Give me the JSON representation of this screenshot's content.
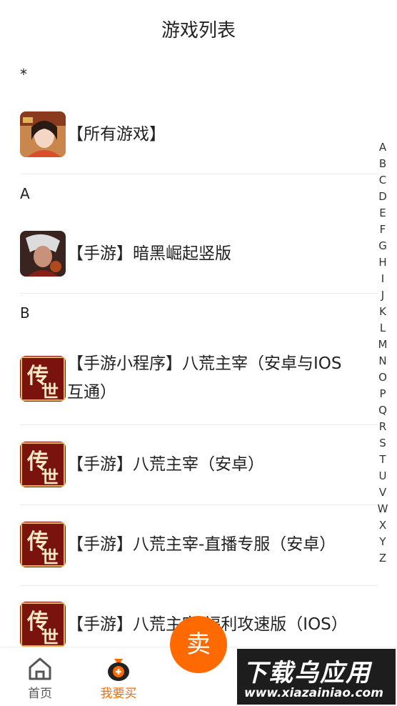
{
  "header": {
    "title": "游戏列表"
  },
  "sections": [
    {
      "key": "*",
      "items": [
        {
          "label": "【所有游戏】"
        }
      ]
    },
    {
      "key": "A",
      "items": [
        {
          "label": "【手游】暗黑崛起竖版"
        }
      ]
    },
    {
      "key": "B",
      "items": [
        {
          "label_line1": "【手游小程序】八荒主宰（安卓与IOS",
          "label_line2": "互通）"
        },
        {
          "label": "【手游】八荒主宰（安卓）"
        },
        {
          "label": "【手游】八荒主宰-直播专服（安卓）"
        },
        {
          "label": "【手游】八荒主宰-福利攻速版（IOS）"
        }
      ]
    }
  ],
  "index_letters": [
    "A",
    "B",
    "C",
    "D",
    "E",
    "F",
    "G",
    "H",
    "I",
    "J",
    "K",
    "L",
    "M",
    "N",
    "O",
    "P",
    "Q",
    "R",
    "S",
    "T",
    "U",
    "V",
    "W",
    "X",
    "Y",
    "Z"
  ],
  "tabbar": {
    "home_label": "首页",
    "buy_label": "我要买",
    "sell_label": "卖",
    "home_icon": "home-icon",
    "buy_icon": "money-bag-icon"
  },
  "watermark": {
    "main": "下载乌应用",
    "url": "www.xiazainiao.com"
  },
  "colors": {
    "accent": "#ff6a00"
  }
}
